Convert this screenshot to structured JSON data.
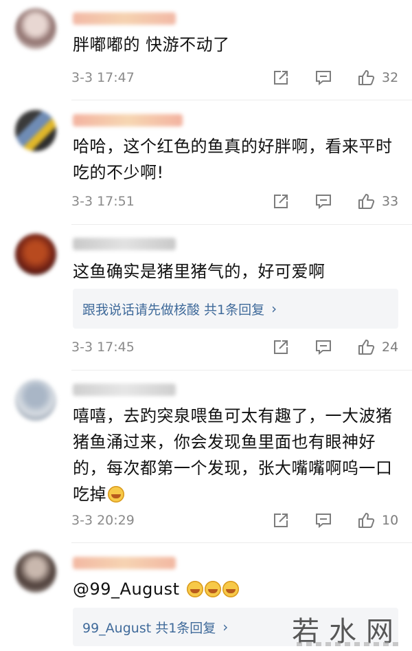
{
  "comments": [
    {
      "text": "胖嘟嘟的 快游不动了",
      "time": "3-3 17:47",
      "likes": "32"
    },
    {
      "text": "哈哈，这个红色的鱼真的好胖啊，看来平时吃的不少啊!",
      "time": "3-3 17:51",
      "likes": "33"
    },
    {
      "text": "这鱼确实是猪里猪气的，好可爱啊",
      "reply_summary": "跟我说话请先做核酸  共1条回复",
      "time": "3-3 17:45",
      "likes": "24"
    },
    {
      "text": "嘻嘻，去趵突泉喂鱼可太有趣了，一大波猪猪鱼涌过来，你会发现鱼里面也有眼神好的，每次都第一个发现，张大嘴嘴啊呜一口吃掉",
      "time": "3-3 20:29",
      "likes": "10"
    },
    {
      "text": "@99_August",
      "reply_summary": "99_August  共1条回复"
    }
  ],
  "icons": {
    "share": "share-icon",
    "comment": "comment-icon",
    "like": "thumbs-up-icon",
    "laugh": "laughing-emoji-icon"
  },
  "watermark": "若水网",
  "colors": {
    "link": "#3f6a9a",
    "meta": "#8a8a8a",
    "reply_bg": "#f4f5f7"
  }
}
